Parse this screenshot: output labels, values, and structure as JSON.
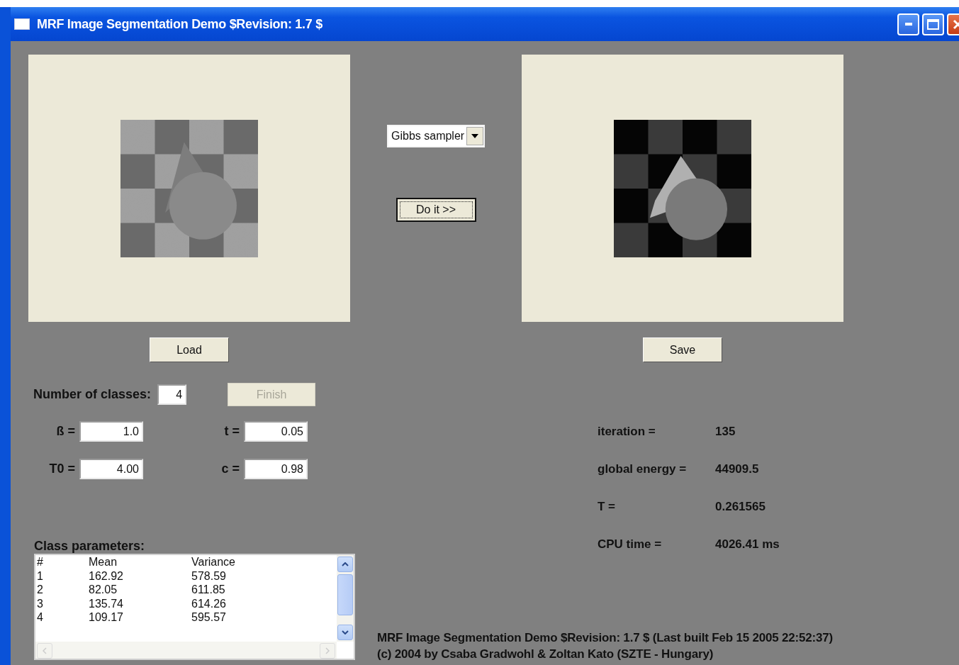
{
  "window": {
    "title": "MRF Image Segmentation Demo $Revision: 1.7 $"
  },
  "method_select": {
    "value": "Gibbs sampler"
  },
  "run_button": {
    "label": "Do it >>",
    "focused": true
  },
  "load_button": {
    "label": "Load"
  },
  "save_button": {
    "label": "Save"
  },
  "num_classes": {
    "label": "Number of classes:",
    "value": "4"
  },
  "finish_button": {
    "label": "Finish",
    "disabled": true
  },
  "params": [
    {
      "label": "ß =",
      "value": "1.0"
    },
    {
      "label": "t =",
      "value": "0.05"
    },
    {
      "label": "T0 =",
      "value": "4.00"
    },
    {
      "label": "c =",
      "value": "0.98"
    }
  ],
  "class_parameters": {
    "label": "Class parameters:",
    "columns": [
      "#",
      "Mean",
      "Variance"
    ],
    "rows": [
      [
        "1",
        "162.92",
        "578.59"
      ],
      [
        "2",
        "82.05",
        "611.85"
      ],
      [
        "3",
        "135.74",
        "614.26"
      ],
      [
        "4",
        "109.17",
        "595.57"
      ]
    ]
  },
  "stats": [
    {
      "label": "iteration =",
      "value": "135"
    },
    {
      "label": "global energy =",
      "value": "44909.5"
    },
    {
      "label": "T =",
      "value": "0.261565"
    },
    {
      "label": "CPU time =",
      "value": "4026.41 ms"
    }
  ],
  "footer": [
    "MRF Image Segmentation Demo $Revision: 1.7 $ (Last built Feb 15 2005 22:52:37)",
    "(c) 2004 by Csaba Gradwohl & Zoltan Kato (SZTE - Hungary)"
  ]
}
